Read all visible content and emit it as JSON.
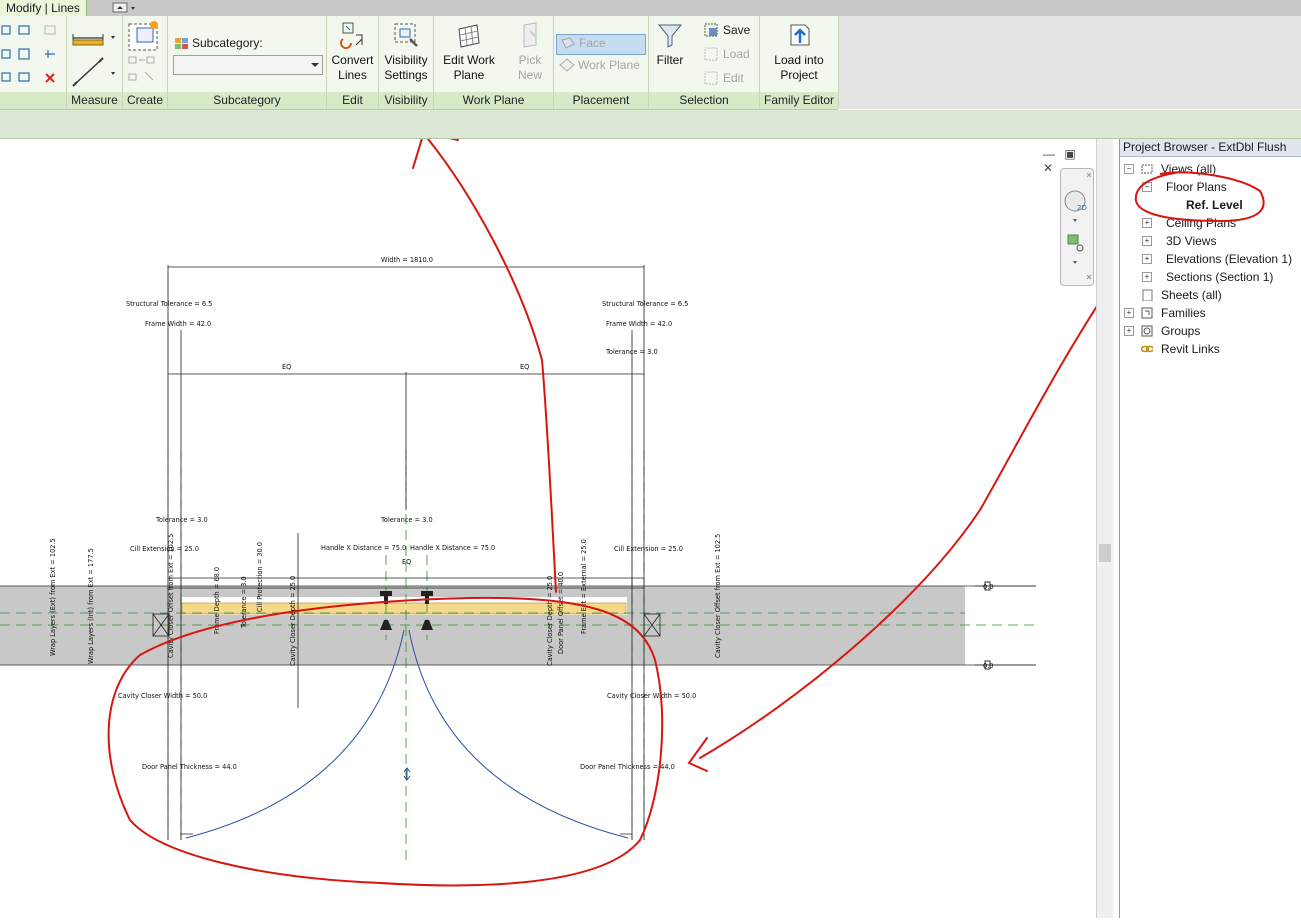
{
  "context_tab": "Modify | Lines",
  "qat_icon": "quick-access-dropdown-icon",
  "panels": {
    "measure": "Measure",
    "create": "Create",
    "subcategory": "Subcategory",
    "edit": "Edit",
    "visibility": "Visibility",
    "work_plane": "Work Plane",
    "placement": "Placement",
    "selection": "Selection",
    "family_editor": "Family Editor"
  },
  "subcategory": {
    "label": "Subcategory:",
    "value": ""
  },
  "tools": {
    "convert_lines": "Convert Lines",
    "visibility_settings": "Visibility Settings",
    "edit_work_plane": "Edit Work Plane",
    "pick_new": "Pick New",
    "face": "Face",
    "work_plane": "Work Plane",
    "filter": "Filter",
    "save": "Save",
    "load": "Load",
    "edit": "Edit",
    "load_into_project": "Load into Project"
  },
  "project_browser": {
    "title": "Project Browser - ExtDbl Flush",
    "items": [
      {
        "label": "Views (all)",
        "expanded": true
      },
      {
        "label": "Floor Plans",
        "expanded": true
      },
      {
        "label": "Ref. Level",
        "bold": true
      },
      {
        "label": "Ceiling Plans",
        "expanded": false
      },
      {
        "label": "3D Views",
        "expanded": false
      },
      {
        "label": "Elevations (Elevation 1)",
        "expanded": false
      },
      {
        "label": "Sections (Section 1)",
        "expanded": false
      },
      {
        "label": "Sheets (all)"
      },
      {
        "label": "Families",
        "expanded": false
      },
      {
        "label": "Groups",
        "expanded": false
      },
      {
        "label": "Revit Links"
      }
    ]
  },
  "view_controls": "— ▣ ✕",
  "nav_badge": "2D",
  "drawing": {
    "width": "Width = 1810.0",
    "struct_tol_l": "Structural Tolerance = 6.5",
    "struct_tol_r": "Structural Tolerance = 6.5",
    "frame_width_l": "Frame Width = 42.0",
    "frame_width_r": "Frame Width = 42.0",
    "tolerance_top": "Tolerance = 3.0",
    "eq_left": "EQ",
    "eq_right": "EQ",
    "tol_l": "Tolerance = 3.0",
    "tol_c": "Tolerance = 3.0",
    "cill_ext_l": "Cill Extension = 25.0",
    "cill_ext_r": "Cill Extension = 25.0",
    "handle_l": "Handle X Distance = 75.0",
    "handle_r": "Handle X Distance = 75.0",
    "eq_small": "EQ",
    "ccw_l": "Cavity Closer Width = 50.0",
    "ccw_r": "Cavity Closer Width = 50.0",
    "dpt_l": "Door Panel Thickness = 44.0",
    "dpt_r": "Door Panel Thickness = 44.0",
    "wrap_ext": "Wrap Layers (Ext) from Ext = 102.5",
    "wrap_int": "Wrap Layers (Int) from Ext = 177.5",
    "v_ccoff_l": "Cavity Closer Offset from Ext = 102.5",
    "v_ccoff_r": "Cavity Closer Offset from Ext = 102.5",
    "v_frame_depth": "Frame Depth = 68.0",
    "v_tol": "Tolerance = 3.0",
    "v_cill_prot": "Cill Protection = 30.0",
    "v_ccdepth_l": "Cavity Closer Depth = 25.0",
    "v_ccdepth_r": "Cavity Closer Depth = 25.0",
    "v_dpoff": "Door Panel Offset = 40.0",
    "v_frame_ext": "Frame Ext = External = 25.0",
    "level_0": "0.0",
    "level_1": "0.0"
  },
  "colors": {
    "annotation": "#d9150f",
    "ribbon_panel": "#d7e9c6",
    "guide": "#2e8b2e",
    "swing": "#2a4fa0",
    "cill": "#f5d98a",
    "wall": "#c8c8c8"
  }
}
